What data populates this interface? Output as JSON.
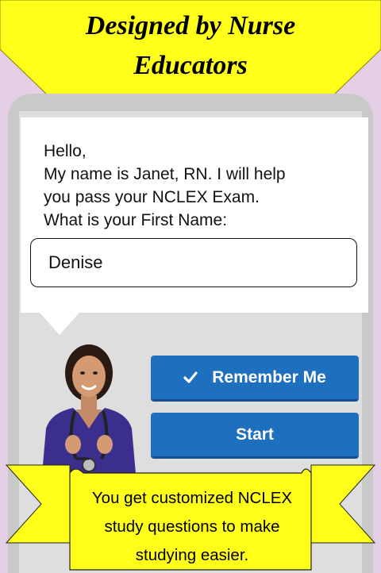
{
  "banner": {
    "title_line1": "Designed by Nurse",
    "title_line2": "Educators"
  },
  "chat": {
    "greeting_line1": "Hello,",
    "greeting_line2": "My name is Janet, RN. I will help",
    "greeting_line3": "you pass your NCLEX Exam.",
    "greeting_line4": "What is your First Name:"
  },
  "name_input": {
    "value": "Denise"
  },
  "buttons": {
    "remember_label": "Remember Me",
    "remember_checked": true,
    "start_label": "Start"
  },
  "promo": {
    "line1": "You get customized NCLEX",
    "line2": "study questions to make",
    "line3": "studying easier."
  },
  "colors": {
    "banner_yellow": "#ffff1a",
    "button_blue": "#1f6fbf",
    "background_purple": "#e4cfe7"
  }
}
